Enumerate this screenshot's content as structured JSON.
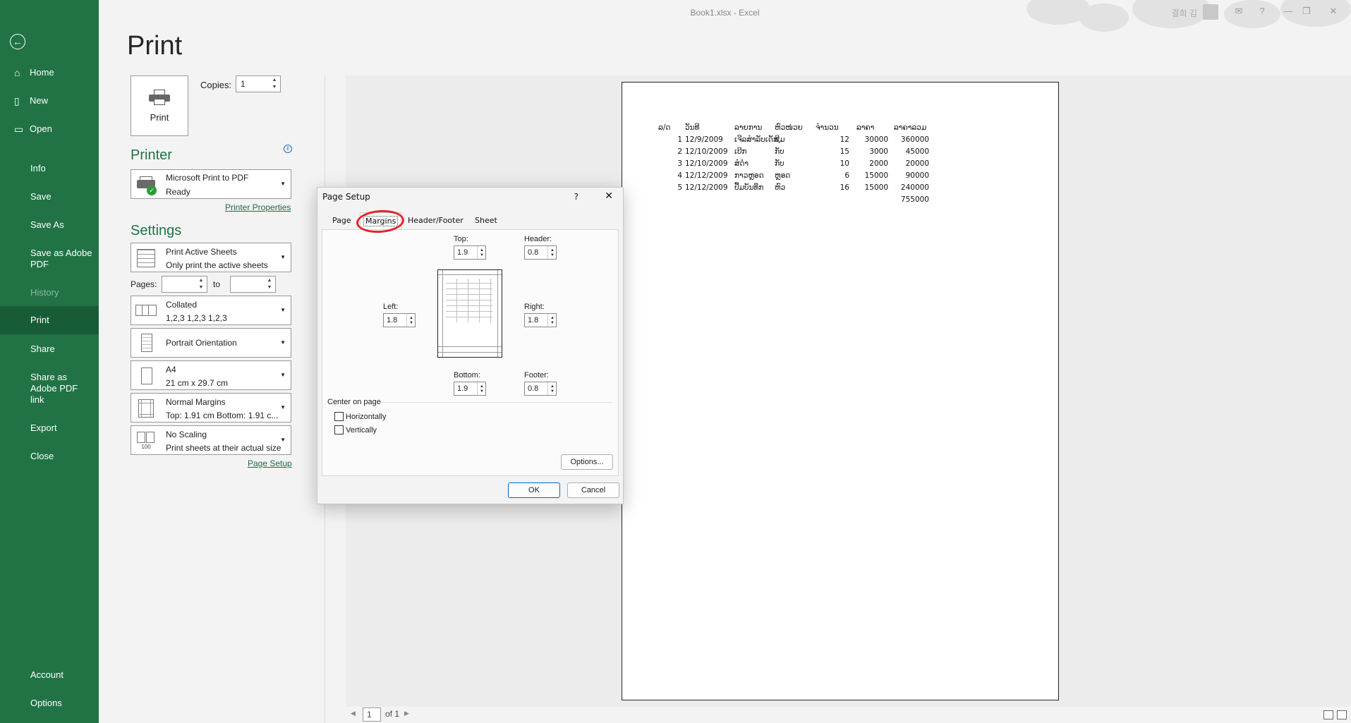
{
  "window": {
    "title": "Book1.xlsx  -  Excel",
    "user": "결희 김"
  },
  "nav": {
    "items": [
      {
        "label": "Home",
        "icon": "home-icon",
        "glyph": "⌂"
      },
      {
        "label": "New",
        "icon": "new-file-icon",
        "glyph": "▯"
      },
      {
        "label": "Open",
        "icon": "open-folder-icon",
        "glyph": "▭"
      },
      {
        "label": "Info"
      },
      {
        "label": "Save"
      },
      {
        "label": "Save As"
      },
      {
        "label": "Save as Adobe PDF"
      },
      {
        "label": "History"
      },
      {
        "label": "Print"
      },
      {
        "label": "Share"
      },
      {
        "label": "Share as Adobe PDF link"
      },
      {
        "label": "Export"
      },
      {
        "label": "Close"
      },
      {
        "label": "Account"
      },
      {
        "label": "Options"
      }
    ]
  },
  "print": {
    "title": "Print",
    "button_label": "Print",
    "copies_label": "Copies:",
    "copies_value": "1",
    "printer_heading": "Printer",
    "printer_name": "Microsoft Print to PDF",
    "printer_status": "Ready",
    "printer_properties": "Printer Properties",
    "settings_heading": "Settings",
    "settings": [
      {
        "l1": "Print Active Sheets",
        "l2": "Only print the active sheets"
      },
      {
        "l1": "Collated",
        "l2": "1,2,3    1,2,3    1,2,3"
      },
      {
        "l1": "Portrait Orientation",
        "l2": ""
      },
      {
        "l1": "A4",
        "l2": "21 cm x 29.7 cm"
      },
      {
        "l1": "Normal Margins",
        "l2": "Top: 1.91 cm Bottom: 1.91 c..."
      },
      {
        "l1": "No Scaling",
        "l2": "Print sheets at their actual size"
      }
    ],
    "pages_label": "Pages:",
    "to_label": "to",
    "page_setup_link": "Page Setup"
  },
  "preview": {
    "headers": [
      "ລ/ດ",
      "ວັນທີ",
      "ລາຍການ",
      "ຫົວໜ່ວຍ",
      "ຈຳນວນ",
      "ລາຄາ",
      "ລາຄາລວມ"
    ],
    "rows": [
      [
        "1",
        "12/9/2009",
        "ເຈີລສຳລັບເດັກ",
        "ຊີມ",
        "12",
        "30000",
        "360000"
      ],
      [
        "2",
        "12/10/2009",
        "ເບີກ",
        "ກັບ",
        "15",
        "3000",
        "45000"
      ],
      [
        "3",
        "12/10/2009",
        "ສໍດຳ",
        "ກັບ",
        "10",
        "2000",
        "20000"
      ],
      [
        "4",
        "12/12/2009",
        "ກາວຫຼອດ",
        "ຫຼອດ",
        "6",
        "15000",
        "90000"
      ],
      [
        "5",
        "12/12/2009",
        "ປຶ້ມບັນທຶກ",
        "ຫົວ",
        "16",
        "15000",
        "240000"
      ]
    ],
    "total": "755000",
    "page_current": "1",
    "page_of": "of 1"
  },
  "dialog": {
    "title": "Page Setup",
    "help": "?",
    "tabs": [
      "Page",
      "Margins",
      "Header/Footer",
      "Sheet"
    ],
    "top_label": "Top:",
    "top_value": "1.9",
    "header_label": "Header:",
    "header_value": "0.8",
    "left_label": "Left:",
    "left_value": "1.8",
    "right_label": "Right:",
    "right_value": "1.8",
    "bottom_label": "Bottom:",
    "bottom_value": "1.9",
    "footer_label": "Footer:",
    "footer_value": "0.8",
    "center_label": "Center on page",
    "horizontally": "Horizontally",
    "vertically": "Vertically",
    "options_btn": "Options...",
    "ok_btn": "OK",
    "cancel_btn": "Cancel",
    "highlight_color": "#e0262d"
  },
  "colors": {
    "nav_bg": "#217346",
    "nav_active": "#185c37",
    "accent": "#217346"
  }
}
